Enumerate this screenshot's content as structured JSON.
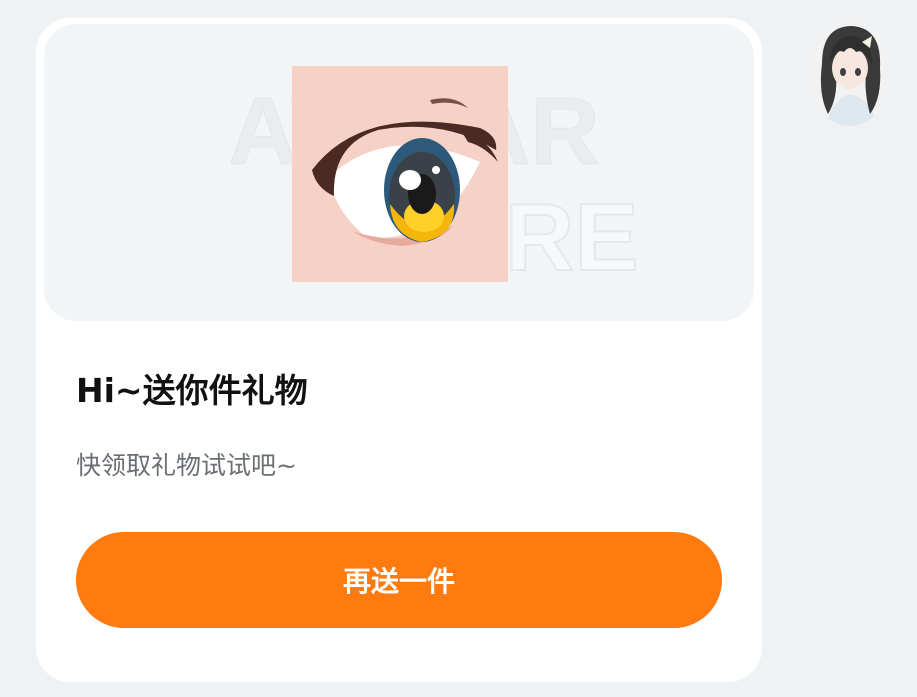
{
  "watermark": {
    "line1": "AVATAR",
    "line2": "STORE"
  },
  "item": {
    "icon": "anime-eye-icon",
    "iris_color": "#f5b60c",
    "skin_color": "#f6d2c6"
  },
  "message": {
    "title": "Hi~送你件礼物",
    "subtitle": "快领取礼物试试吧~"
  },
  "actions": {
    "send_again_label": "再送一件"
  },
  "colors": {
    "accent": "#ff7a0f",
    "card_background": "#ffffff",
    "page_background": "#eef2f5"
  }
}
